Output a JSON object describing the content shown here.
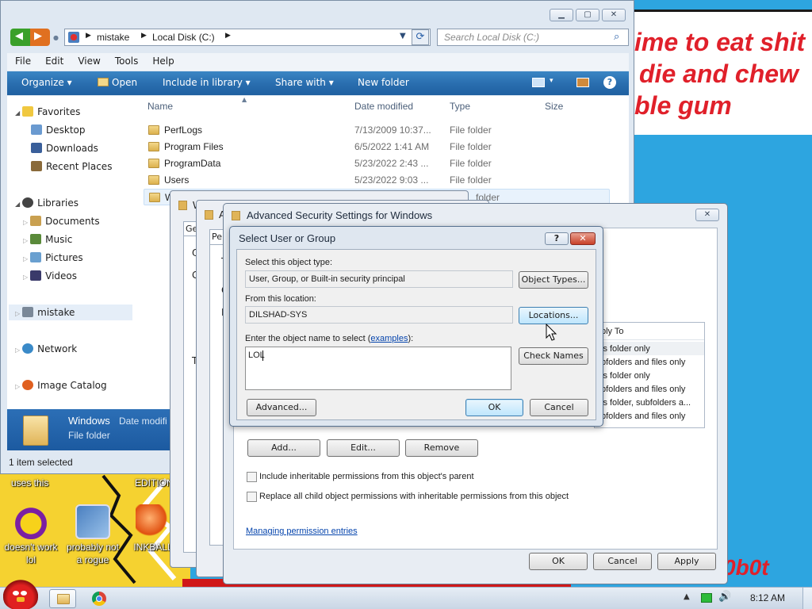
{
  "wallpaper": {
    "note_lines": [
      "ime to eat shit",
      "die and chew",
      "ble gum"
    ],
    "bottom_text": "0b0t",
    "caption_left": "uses this",
    "caption_mid": "EDITION",
    "colors": {
      "sky": "#2da5e0",
      "note_red": "#e0202a",
      "yellow": "#f5d230"
    }
  },
  "desktop_icons": [
    {
      "label": "doesn't work lol",
      "icon": "yahoo-messenger-icon"
    },
    {
      "label": "probably not a rogue",
      "icon": "gears-setup-icon"
    },
    {
      "label": "INKBALL",
      "icon": "inkball-icon"
    }
  ],
  "explorer": {
    "address": {
      "path": [
        "mistake",
        "Local Disk (C:)"
      ]
    },
    "search_placeholder": "Search Local Disk (C:)",
    "menu": [
      "File",
      "Edit",
      "View",
      "Tools",
      "Help"
    ],
    "commands": [
      "Organize",
      "Open",
      "Include in library",
      "Share with",
      "New folder"
    ],
    "nav": {
      "favorites": "Favorites",
      "favorite_items": [
        "Desktop",
        "Downloads",
        "Recent Places"
      ],
      "libraries": "Libraries",
      "library_items": [
        "Documents",
        "Music",
        "Pictures",
        "Videos"
      ],
      "computer": "mistake",
      "network": "Network",
      "image_catalog": "Image Catalog"
    },
    "columns": [
      "Name",
      "Date modified",
      "Type",
      "Size"
    ],
    "files": [
      {
        "name": "PerfLogs",
        "date": "7/13/2009 10:37...",
        "type": "File folder"
      },
      {
        "name": "Program Files",
        "date": "6/5/2022 1:41 AM",
        "type": "File folder"
      },
      {
        "name": "ProgramData",
        "date": "5/23/2022 2:43 ...",
        "type": "File folder"
      },
      {
        "name": "Users",
        "date": "5/23/2022 9:03 ...",
        "type": "File folder"
      },
      {
        "name": "W",
        "date": "",
        "type": "folder"
      }
    ],
    "details": {
      "name": "Windows",
      "date_label": "Date modifi",
      "type": "File folder"
    },
    "status": "1 item selected"
  },
  "prop_windows": {
    "back_title": "W",
    "mid_title": "A",
    "back_tab": "Ge",
    "mid_tab": "Pe"
  },
  "advanced": {
    "title": "Advanced Security Settings for Windows",
    "perm_header": "ply To",
    "perm_rows": [
      "is folder only",
      "bfolders and files only",
      "is folder only",
      "bfolders and files only",
      "is folder, subfolders a...",
      "bfolders and files only"
    ],
    "buttons": {
      "add": "Add...",
      "edit": "Edit...",
      "remove": "Remove",
      "ok": "OK",
      "cancel": "Cancel",
      "apply": "Apply"
    },
    "inherit_checkbox": "Include inheritable permissions from this object's parent",
    "replace_checkbox": "Replace all child object permissions with inheritable permissions from this object",
    "link": "Managing permission entries",
    "left_fragments": [
      "T",
      "O",
      "P"
    ]
  },
  "select_dialog": {
    "title": "Select User or Group",
    "object_type_label": "Select this object type:",
    "object_type_value": "User, Group, or Built-in security principal",
    "object_types_button": "Object Types...",
    "location_label": "From this location:",
    "location_value": "DILSHAD-SYS",
    "locations_button": "Locations...",
    "name_label": "Enter the object name to select (",
    "name_label_link": "examples",
    "name_label_end": "):",
    "name_value": "LOL",
    "check_names_button": "Check Names",
    "advanced_button": "Advanced...",
    "ok_button": "OK",
    "cancel_button": "Cancel",
    "help_glyph": "?",
    "close_glyph": "✕"
  },
  "taskbar": {
    "clock": "8:12 AM"
  }
}
